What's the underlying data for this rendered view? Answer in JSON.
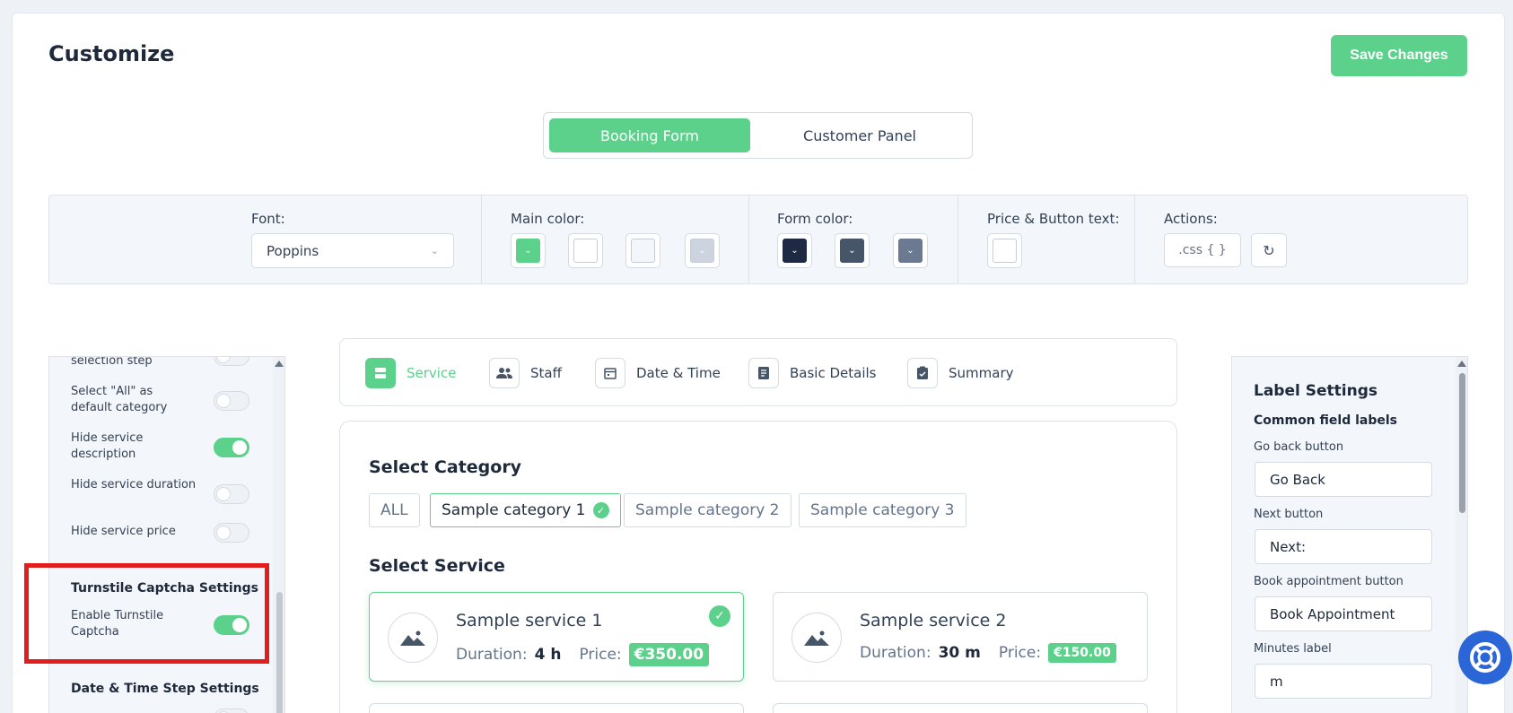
{
  "header": {
    "title": "Customize",
    "save_label": "Save Changes"
  },
  "switcher": {
    "tabs": [
      "Booking Form",
      "Customer Panel"
    ]
  },
  "toolbar": {
    "font_label": "Font:",
    "font_value": "Poppins",
    "main_color_label": "Main color:",
    "form_color_label": "Form color:",
    "price_button_label": "Price & Button text:",
    "actions_label": "Actions:",
    "css_label": ".css { }",
    "main_colors": [
      "#5cd18b",
      "#ffffff",
      "#f3f6fa",
      "#ced4df"
    ],
    "form_colors": [
      "#1e2a44",
      "#475569",
      "#6b7a90"
    ],
    "price_button_color": "#ffffff"
  },
  "left_panel": {
    "rows": [
      {
        "label": "selection step",
        "on": false
      },
      {
        "label": "Select \"All\" as default category",
        "on": false
      },
      {
        "label": "Hide service description",
        "on": true
      },
      {
        "label": "Hide service duration",
        "on": false
      },
      {
        "label": "Hide service price",
        "on": false
      }
    ],
    "captcha_section": "Turnstile Captcha Settings",
    "captcha_toggle_label": "Enable Turnstile Captcha",
    "datetime_section": "Date & Time Step Settings"
  },
  "steps": [
    "Service",
    "Staff",
    "Date & Time",
    "Basic Details",
    "Summary"
  ],
  "form": {
    "category_heading": "Select Category",
    "categories": [
      "ALL",
      "Sample category 1",
      "Sample category 2",
      "Sample category 3"
    ],
    "service_heading": "Select Service",
    "services": [
      {
        "name": "Sample service 1",
        "duration_label": "Duration:",
        "duration": "4 h",
        "price_label": "Price:",
        "price": "€350.00"
      },
      {
        "name": "Sample service 2",
        "duration_label": "Duration:",
        "duration": "30 m",
        "price_label": "Price:",
        "price": "€150.00"
      }
    ]
  },
  "right_panel": {
    "title": "Label Settings",
    "subtitle": "Common field labels",
    "fields": [
      {
        "label": "Go back button",
        "value": "Go Back"
      },
      {
        "label": "Next button",
        "value": "Next:"
      },
      {
        "label": "Book appointment button",
        "value": "Book Appointment"
      },
      {
        "label": "Minutes label",
        "value": "m"
      }
    ]
  },
  "colors": {
    "accent": "#5cd18b",
    "highlight": "#e11d1d",
    "help": "#2b66d9"
  }
}
